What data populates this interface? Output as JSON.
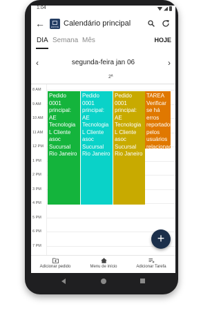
{
  "status_bar": {
    "time": "1:04"
  },
  "app_bar": {
    "title": "Calendário principal",
    "logo_text": "ESTATE"
  },
  "view_tabs": {
    "day": "DIA",
    "week": "Semana",
    "month": "Mês",
    "today": "HOJE",
    "selected": "DIA"
  },
  "day_nav": {
    "label": "segunda-feira jan 06"
  },
  "day_header": {
    "label": "2ª"
  },
  "hours": [
    "8 AM",
    "9 AM",
    "10 AM",
    "11 AM",
    "12 PM",
    "1 PM",
    "2 PM",
    "3 PM",
    "4 PM",
    "5 PM",
    "6 PM",
    "7 PM"
  ],
  "events": [
    {
      "text": "Pedido 0001 principal: AE Tecnologia L Cliente asoc Sucursal Rio Janeiro",
      "color": "#14b43c"
    },
    {
      "text": "Pedido 0001 principal: AE Tecnologia L Cliente asoc Sucursal Rio Janeiro",
      "color": "#0ad2c8"
    },
    {
      "text": "Pedido 0001 principal: AE Tecnologia L Cliente asoc Sucursal Rio Janeiro",
      "color": "#c8aa00"
    },
    {
      "text": "TAREA Verificar se há erros reportador pelos usuários relacionad a s",
      "color": "#e07800"
    }
  ],
  "fab": {
    "label": "+"
  },
  "bottom_nav": [
    {
      "label": "Adicionar pedido",
      "icon": "folder-add-icon"
    },
    {
      "label": "Menu de início",
      "icon": "home-icon"
    },
    {
      "label": "Adicionar Tarefa",
      "icon": "checklist-add-icon"
    }
  ]
}
